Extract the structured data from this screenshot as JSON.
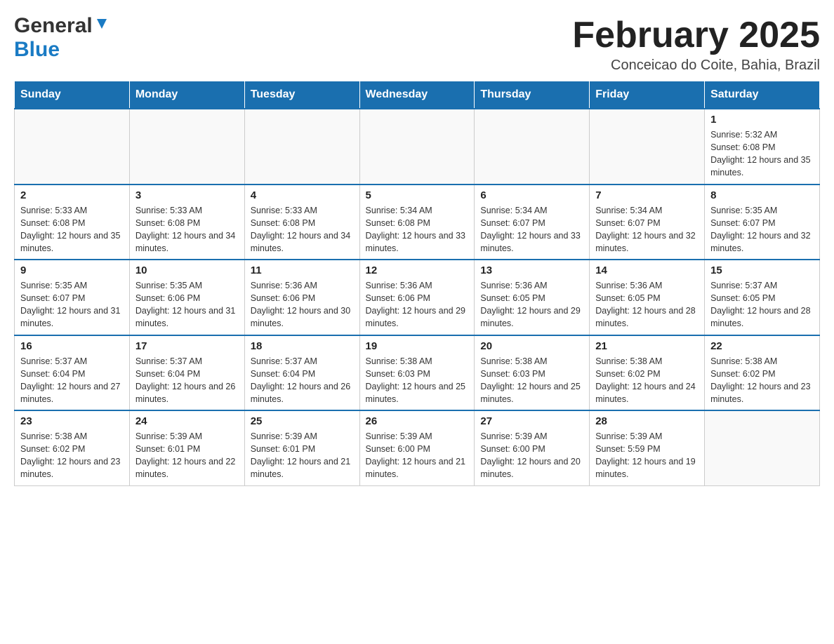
{
  "header": {
    "logo_general": "General",
    "logo_blue": "Blue",
    "title": "February 2025",
    "subtitle": "Conceicao do Coite, Bahia, Brazil"
  },
  "days_of_week": [
    "Sunday",
    "Monday",
    "Tuesday",
    "Wednesday",
    "Thursday",
    "Friday",
    "Saturday"
  ],
  "weeks": [
    [
      {
        "day": "",
        "info": ""
      },
      {
        "day": "",
        "info": ""
      },
      {
        "day": "",
        "info": ""
      },
      {
        "day": "",
        "info": ""
      },
      {
        "day": "",
        "info": ""
      },
      {
        "day": "",
        "info": ""
      },
      {
        "day": "1",
        "info": "Sunrise: 5:32 AM\nSunset: 6:08 PM\nDaylight: 12 hours and 35 minutes."
      }
    ],
    [
      {
        "day": "2",
        "info": "Sunrise: 5:33 AM\nSunset: 6:08 PM\nDaylight: 12 hours and 35 minutes."
      },
      {
        "day": "3",
        "info": "Sunrise: 5:33 AM\nSunset: 6:08 PM\nDaylight: 12 hours and 34 minutes."
      },
      {
        "day": "4",
        "info": "Sunrise: 5:33 AM\nSunset: 6:08 PM\nDaylight: 12 hours and 34 minutes."
      },
      {
        "day": "5",
        "info": "Sunrise: 5:34 AM\nSunset: 6:08 PM\nDaylight: 12 hours and 33 minutes."
      },
      {
        "day": "6",
        "info": "Sunrise: 5:34 AM\nSunset: 6:07 PM\nDaylight: 12 hours and 33 minutes."
      },
      {
        "day": "7",
        "info": "Sunrise: 5:34 AM\nSunset: 6:07 PM\nDaylight: 12 hours and 32 minutes."
      },
      {
        "day": "8",
        "info": "Sunrise: 5:35 AM\nSunset: 6:07 PM\nDaylight: 12 hours and 32 minutes."
      }
    ],
    [
      {
        "day": "9",
        "info": "Sunrise: 5:35 AM\nSunset: 6:07 PM\nDaylight: 12 hours and 31 minutes."
      },
      {
        "day": "10",
        "info": "Sunrise: 5:35 AM\nSunset: 6:06 PM\nDaylight: 12 hours and 31 minutes."
      },
      {
        "day": "11",
        "info": "Sunrise: 5:36 AM\nSunset: 6:06 PM\nDaylight: 12 hours and 30 minutes."
      },
      {
        "day": "12",
        "info": "Sunrise: 5:36 AM\nSunset: 6:06 PM\nDaylight: 12 hours and 29 minutes."
      },
      {
        "day": "13",
        "info": "Sunrise: 5:36 AM\nSunset: 6:05 PM\nDaylight: 12 hours and 29 minutes."
      },
      {
        "day": "14",
        "info": "Sunrise: 5:36 AM\nSunset: 6:05 PM\nDaylight: 12 hours and 28 minutes."
      },
      {
        "day": "15",
        "info": "Sunrise: 5:37 AM\nSunset: 6:05 PM\nDaylight: 12 hours and 28 minutes."
      }
    ],
    [
      {
        "day": "16",
        "info": "Sunrise: 5:37 AM\nSunset: 6:04 PM\nDaylight: 12 hours and 27 minutes."
      },
      {
        "day": "17",
        "info": "Sunrise: 5:37 AM\nSunset: 6:04 PM\nDaylight: 12 hours and 26 minutes."
      },
      {
        "day": "18",
        "info": "Sunrise: 5:37 AM\nSunset: 6:04 PM\nDaylight: 12 hours and 26 minutes."
      },
      {
        "day": "19",
        "info": "Sunrise: 5:38 AM\nSunset: 6:03 PM\nDaylight: 12 hours and 25 minutes."
      },
      {
        "day": "20",
        "info": "Sunrise: 5:38 AM\nSunset: 6:03 PM\nDaylight: 12 hours and 25 minutes."
      },
      {
        "day": "21",
        "info": "Sunrise: 5:38 AM\nSunset: 6:02 PM\nDaylight: 12 hours and 24 minutes."
      },
      {
        "day": "22",
        "info": "Sunrise: 5:38 AM\nSunset: 6:02 PM\nDaylight: 12 hours and 23 minutes."
      }
    ],
    [
      {
        "day": "23",
        "info": "Sunrise: 5:38 AM\nSunset: 6:02 PM\nDaylight: 12 hours and 23 minutes."
      },
      {
        "day": "24",
        "info": "Sunrise: 5:39 AM\nSunset: 6:01 PM\nDaylight: 12 hours and 22 minutes."
      },
      {
        "day": "25",
        "info": "Sunrise: 5:39 AM\nSunset: 6:01 PM\nDaylight: 12 hours and 21 minutes."
      },
      {
        "day": "26",
        "info": "Sunrise: 5:39 AM\nSunset: 6:00 PM\nDaylight: 12 hours and 21 minutes."
      },
      {
        "day": "27",
        "info": "Sunrise: 5:39 AM\nSunset: 6:00 PM\nDaylight: 12 hours and 20 minutes."
      },
      {
        "day": "28",
        "info": "Sunrise: 5:39 AM\nSunset: 5:59 PM\nDaylight: 12 hours and 19 minutes."
      },
      {
        "day": "",
        "info": ""
      }
    ]
  ]
}
